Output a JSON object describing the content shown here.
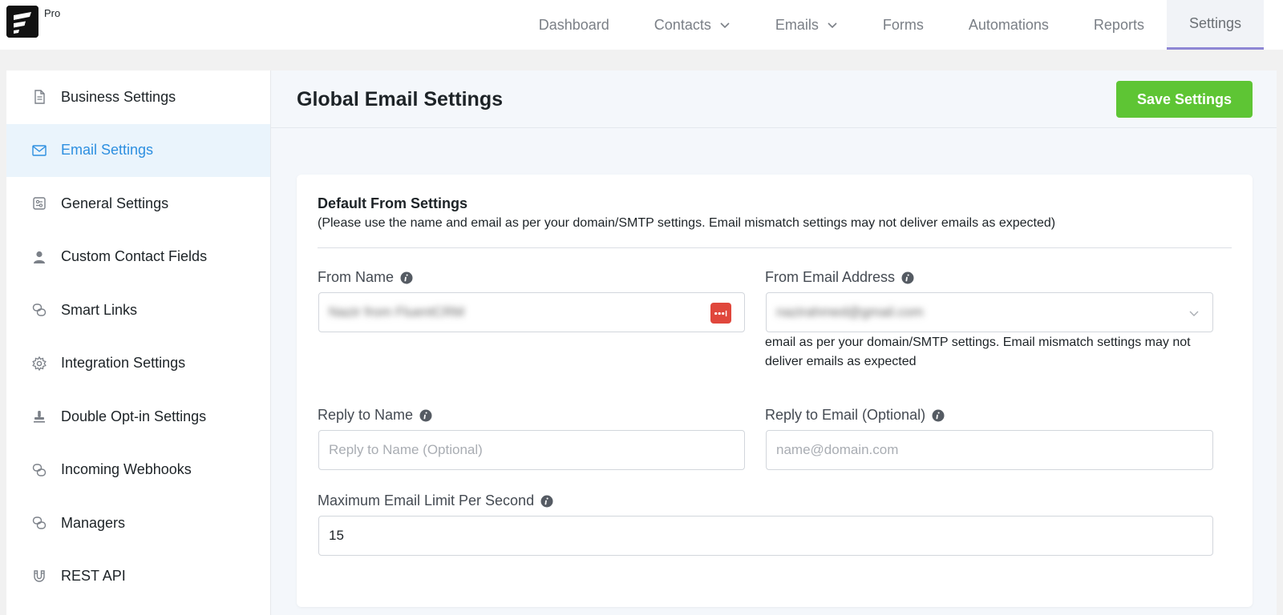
{
  "brand": {
    "badge": "Pro"
  },
  "nav": {
    "items": [
      {
        "label": "Dashboard",
        "has_dropdown": false,
        "active": false
      },
      {
        "label": "Contacts",
        "has_dropdown": true,
        "active": false
      },
      {
        "label": "Emails",
        "has_dropdown": true,
        "active": false
      },
      {
        "label": "Forms",
        "has_dropdown": false,
        "active": false
      },
      {
        "label": "Automations",
        "has_dropdown": false,
        "active": false
      },
      {
        "label": "Reports",
        "has_dropdown": false,
        "active": false
      },
      {
        "label": "Settings",
        "has_dropdown": false,
        "active": true
      }
    ]
  },
  "sidebar": {
    "items": [
      {
        "label": "Business Settings",
        "icon": "document-icon"
      },
      {
        "label": "Email Settings",
        "icon": "envelope-icon",
        "active": true
      },
      {
        "label": "General Settings",
        "icon": "sliders-icon"
      },
      {
        "label": "Custom Contact Fields",
        "icon": "user-icon"
      },
      {
        "label": "Smart Links",
        "icon": "link-icon"
      },
      {
        "label": "Integration Settings",
        "icon": "gear-icon"
      },
      {
        "label": "Double Opt-in Settings",
        "icon": "stamp-icon"
      },
      {
        "label": "Incoming Webhooks",
        "icon": "link-icon"
      },
      {
        "label": "Managers",
        "icon": "link-icon"
      },
      {
        "label": "REST API",
        "icon": "magnet-icon"
      }
    ]
  },
  "main": {
    "title": "Global Email Settings",
    "save_label": "Save Settings"
  },
  "form": {
    "section_title": "Default From Settings",
    "section_note": "(Please use the name and email as per your domain/SMTP settings. Email mismatch settings may not deliver emails as expected)",
    "from_name": {
      "label": "From Name",
      "value": "Nazir from FluentCRM"
    },
    "from_email": {
      "label": "From Email Address",
      "value": "nazirahmed@gmail.com",
      "help": "email as per your domain/SMTP settings. Email mismatch settings may not deliver emails as expected"
    },
    "reply_name": {
      "label": "Reply to Name",
      "placeholder": "Reply to Name (Optional)"
    },
    "reply_email": {
      "label": "Reply to Email (Optional)",
      "placeholder": "name@domain.com"
    },
    "max_limit": {
      "label": "Maximum Email Limit Per Second",
      "value": "15"
    }
  },
  "colors": {
    "accent": "#2d8fe0",
    "save_button": "#5ec534",
    "password_badge": "#e0473c"
  }
}
